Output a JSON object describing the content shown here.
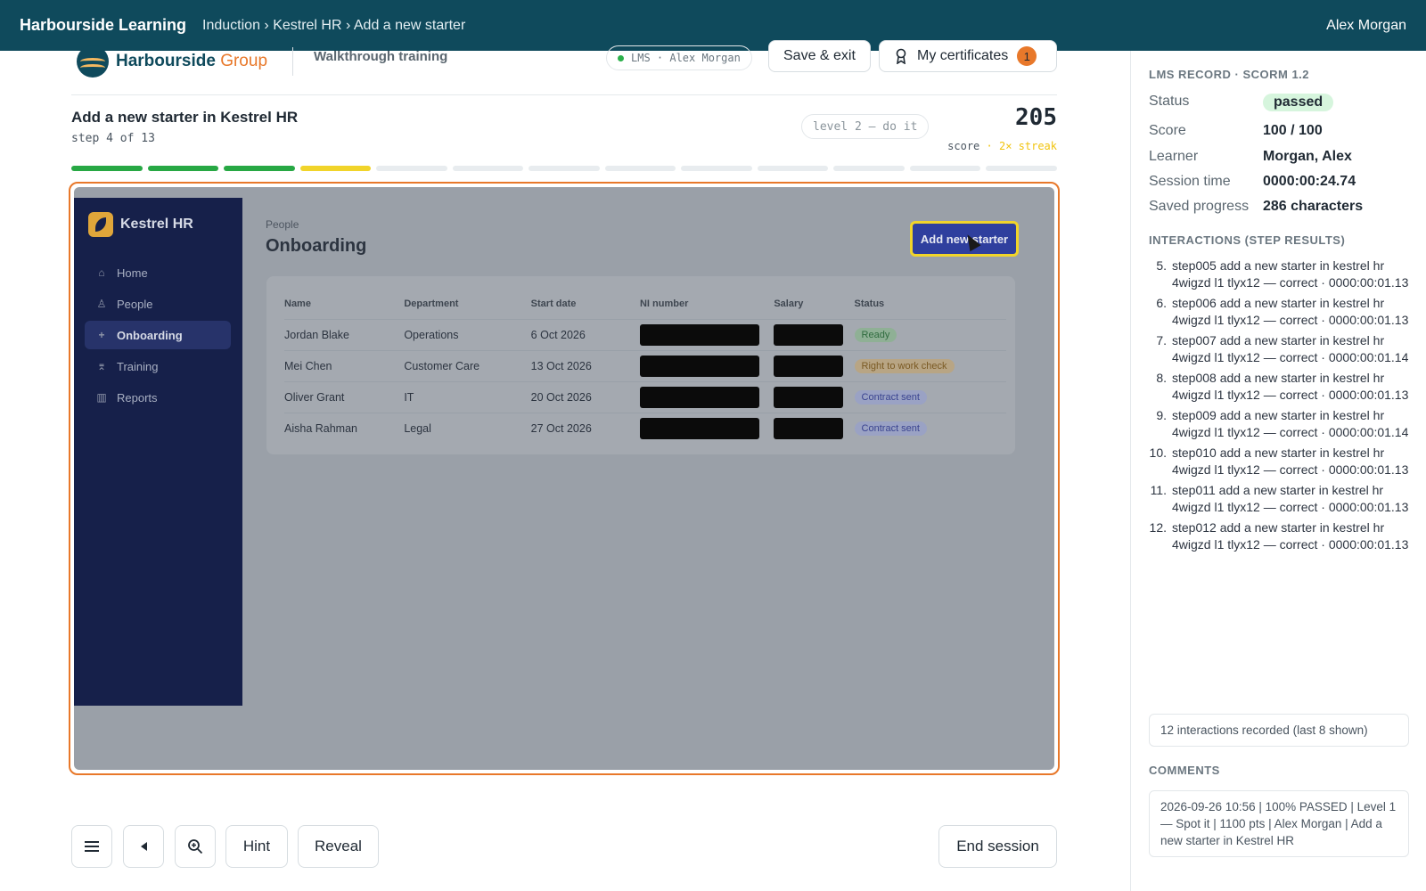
{
  "topbar": {
    "app_title": "Harbourside Learning",
    "breadcrumb": "Induction › Kestrel HR › Add a new starter",
    "user": "Alex Morgan"
  },
  "header": {
    "brand_main": "Harbourside",
    "brand_accent": "Group",
    "walkthrough_label": "Walkthrough training",
    "lms_pill": "LMS · Alex Morgan",
    "save_label": "Save & exit",
    "certs_label": "My certificates",
    "certs_count": "1"
  },
  "task": {
    "title": "Add a new starter in Kestrel HR",
    "step": "step 4 of 13",
    "level": "level 2 — do it",
    "score": "205",
    "score_label": "score",
    "streak": "· 2× streak",
    "progress": [
      "done",
      "done",
      "done",
      "current",
      "todo",
      "todo",
      "todo",
      "todo",
      "todo",
      "todo",
      "todo",
      "todo",
      "todo"
    ]
  },
  "colors": {
    "done": "#27a844",
    "current": "#f1d42a",
    "todo": "#e8ecef",
    "accent": "#e8782a"
  },
  "kestrel": {
    "app_name": "Kestrel HR",
    "nav": [
      {
        "label": "Home",
        "icon": "home-icon",
        "glyph": "⌂"
      },
      {
        "label": "People",
        "icon": "person-icon",
        "glyph": "♙"
      },
      {
        "label": "Onboarding",
        "icon": "plus-icon",
        "glyph": "+"
      },
      {
        "label": "Training",
        "icon": "graduation-cap-icon",
        "glyph": "⌆"
      },
      {
        "label": "Reports",
        "icon": "bar-chart-icon",
        "glyph": "▥"
      }
    ],
    "crumb": "People",
    "title": "Onboarding",
    "add_button": "Add new starter",
    "columns": [
      "Name",
      "Department",
      "Start date",
      "NI number",
      "Salary",
      "Status"
    ],
    "rows": [
      {
        "name": "Jordan Blake",
        "dept": "Operations",
        "start": "6 Oct 2026",
        "status": "Ready",
        "kind": "ready"
      },
      {
        "name": "Mei Chen",
        "dept": "Customer Care",
        "start": "13 Oct 2026",
        "status": "Right to work check",
        "kind": "rtw"
      },
      {
        "name": "Oliver Grant",
        "dept": "IT",
        "start": "20 Oct 2026",
        "status": "Contract sent",
        "kind": "sent"
      },
      {
        "name": "Aisha Rahman",
        "dept": "Legal",
        "start": "27 Oct 2026",
        "status": "Contract sent",
        "kind": "sent"
      }
    ]
  },
  "controls": {
    "menu_icon": "menu-icon",
    "back_icon": "back-icon",
    "zoom_icon": "zoom-icon",
    "hint": "Hint",
    "reveal": "Reveal",
    "end": "End session"
  },
  "panel": {
    "record_heading": "LMS RECORD · SCORM 1.2",
    "status_label": "Status",
    "status_value": "passed",
    "score_label": "Score",
    "score_value": "100 / 100",
    "learner_label": "Learner",
    "learner_value": "Morgan, Alex",
    "session_label": "Session time",
    "session_value": "0000:00:24.74",
    "saved_label": "Saved progress",
    "saved_value": "286 characters",
    "interactions_heading": "INTERACTIONS (STEP RESULTS)",
    "interactions": [
      {
        "n": "5.",
        "text": "step005 add a new starter in kestrel hr 4wigzd l1 tlyx12 — correct · 0000:00:01.13"
      },
      {
        "n": "6.",
        "text": "step006 add a new starter in kestrel hr 4wigzd l1 tlyx12 — correct · 0000:00:01.13"
      },
      {
        "n": "7.",
        "text": "step007 add a new starter in kestrel hr 4wigzd l1 tlyx12 — correct · 0000:00:01.14"
      },
      {
        "n": "8.",
        "text": "step008 add a new starter in kestrel hr 4wigzd l1 tlyx12 — correct · 0000:00:01.13"
      },
      {
        "n": "9.",
        "text": "step009 add a new starter in kestrel hr 4wigzd l1 tlyx12 — correct · 0000:00:01.14"
      },
      {
        "n": "10.",
        "text": "step010 add a new starter in kestrel hr 4wigzd l1 tlyx12 — correct · 0000:00:01.13"
      },
      {
        "n": "11.",
        "text": "step011 add a new starter in kestrel hr 4wigzd l1 tlyx12 — correct · 0000:00:01.13"
      },
      {
        "n": "12.",
        "text": "step012 add a new starter in kestrel hr 4wigzd l1 tlyx12 — correct · 0000:00:01.13"
      }
    ],
    "interactions_note": "12 interactions recorded (last 8 shown)",
    "comments_heading": "COMMENTS",
    "comment": "2026-09-26 10:56 | 100% PASSED | Level 1 — Spot it | 1100 pts | Alex Morgan | Add a new starter in Kestrel HR"
  }
}
